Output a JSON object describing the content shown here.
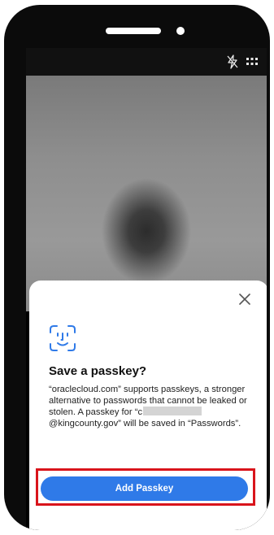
{
  "icons": {
    "flash": "flash-off-icon",
    "menu": "grid-icon",
    "close": "close-icon",
    "faceid": "face-id-icon"
  },
  "sheet": {
    "title": "Save a passkey?",
    "description_line1": "“oraclecloud.com” supports passkeys, a stronger alternative to passwords that cannot be leaked or stolen. A passkey for",
    "email_prefix": "“c",
    "email_suffix": "@kingcounty.gov” will be saved in “Passwords”."
  },
  "button": {
    "add_label": "Add Passkey"
  },
  "colors": {
    "accent": "#2f7ae8",
    "highlight": "#d9141b"
  }
}
